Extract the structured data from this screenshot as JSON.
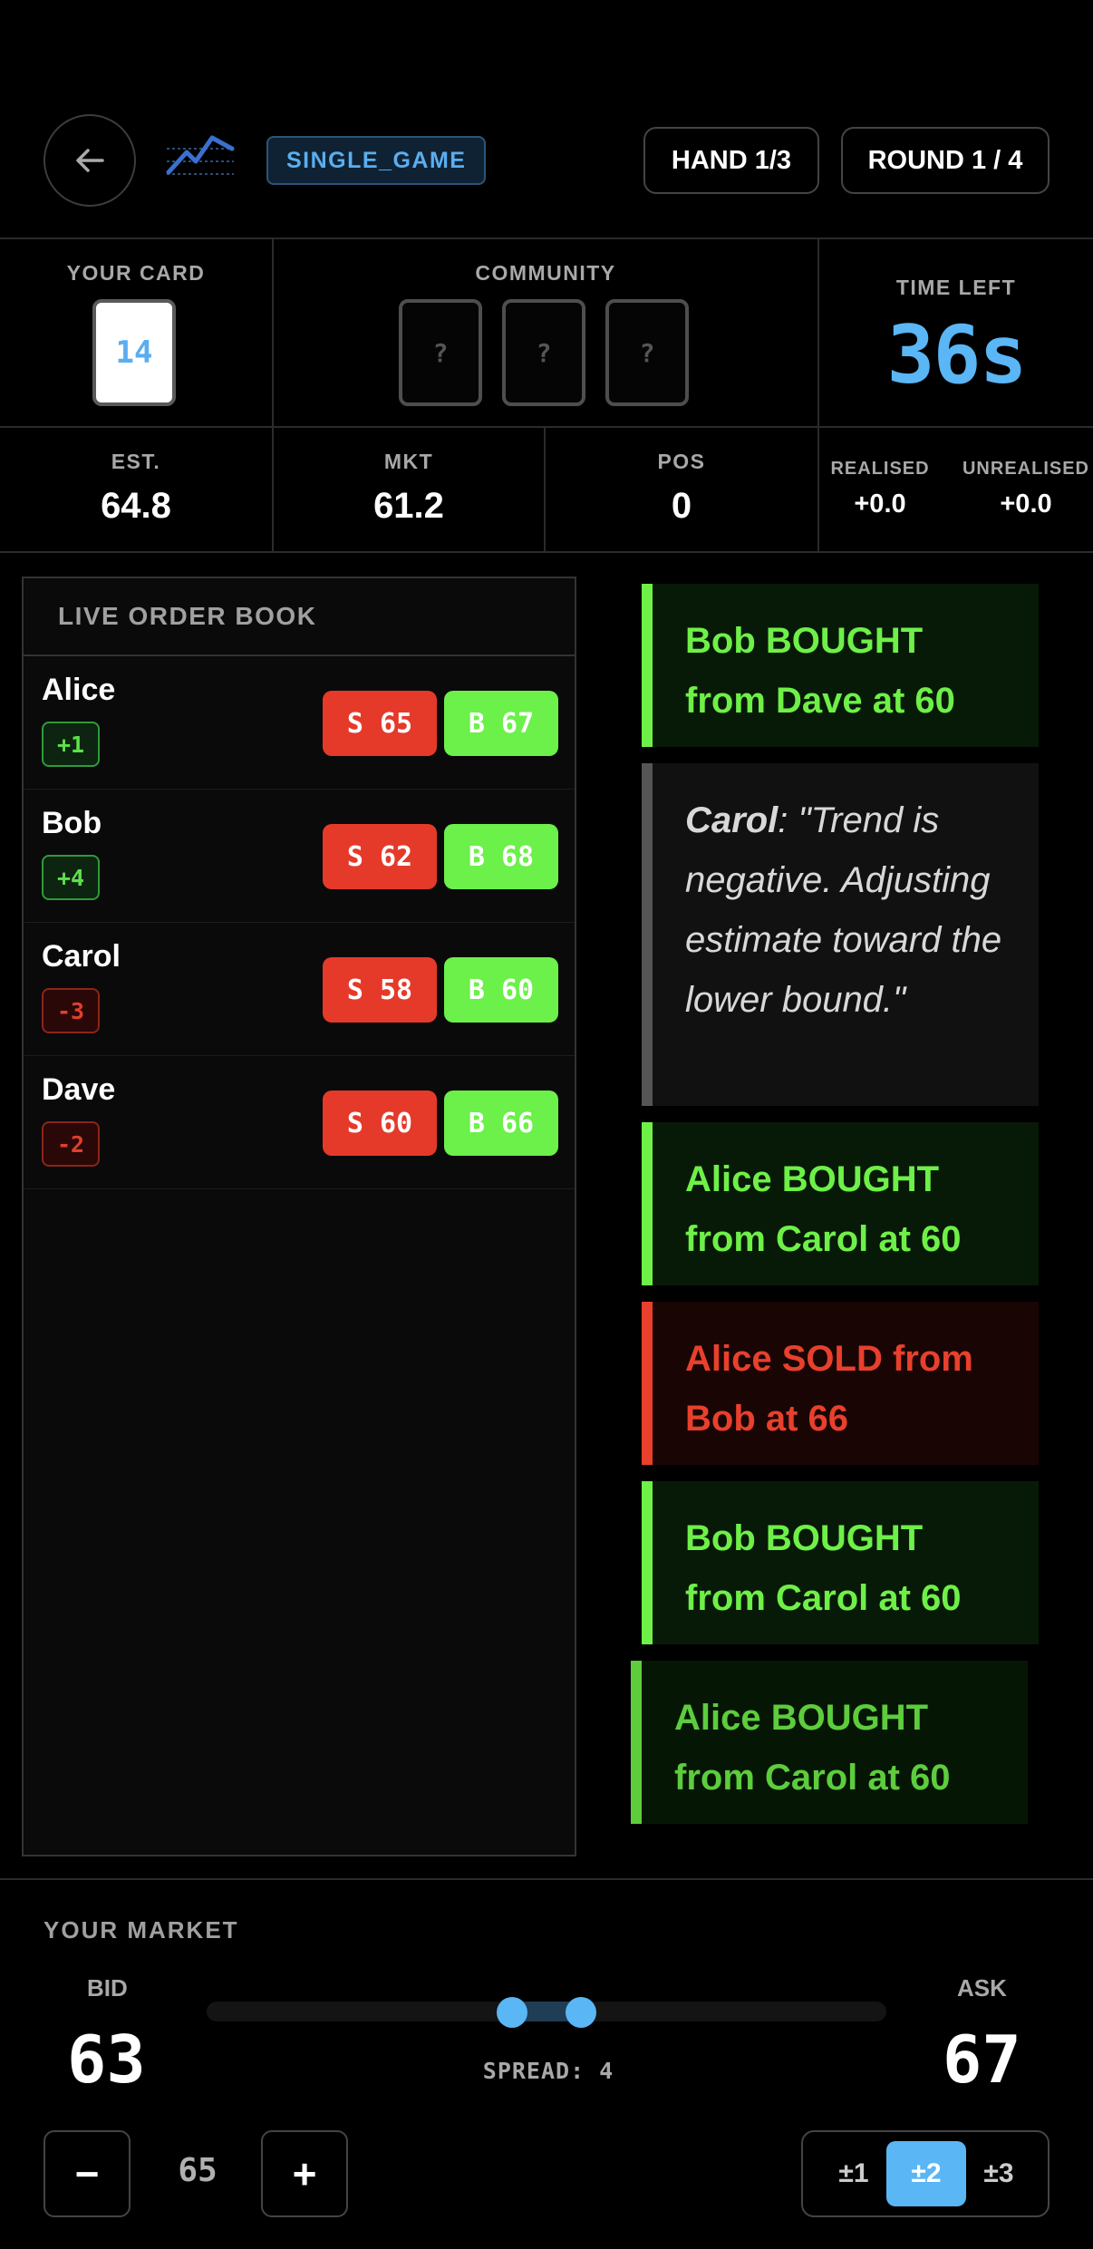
{
  "header": {
    "mode": "SINGLE_GAME",
    "hand": "HAND 1/3",
    "round": "ROUND 1 / 4"
  },
  "cards": {
    "your_card_label": "YOUR CARD",
    "your_card": "14",
    "community_label": "COMMUNITY",
    "community": [
      "?",
      "?",
      "?"
    ],
    "time_left_label": "TIME LEFT",
    "time_left": "36s"
  },
  "stats": {
    "est_label": "EST.",
    "est": "64.8",
    "mkt_label": "MKT",
    "mkt": "61.2",
    "pos_label": "POS",
    "pos": "0",
    "realised_label": "REALISED",
    "realised": "+0.0",
    "unrealised_label": "UNREALISED",
    "unrealised": "+0.0"
  },
  "order_book": {
    "title": "LIVE ORDER BOOK",
    "rows": [
      {
        "name": "Alice",
        "delta": "+1",
        "sell": "S 65",
        "buy": "B 67"
      },
      {
        "name": "Bob",
        "delta": "+4",
        "sell": "S 62",
        "buy": "B 68"
      },
      {
        "name": "Carol",
        "delta": "-3",
        "sell": "S 58",
        "buy": "B 60"
      },
      {
        "name": "Dave",
        "delta": "-2",
        "sell": "S 60",
        "buy": "B 66"
      }
    ]
  },
  "feed": {
    "items": [
      {
        "text": "Bob BOUGHT from Dave at 60"
      },
      {
        "speaker": "Carol",
        "text": ": \"Trend is negative. Adjusting estimate toward the lower bound.\""
      },
      {
        "text": "Alice BOUGHT from Carol at 60"
      },
      {
        "text": "Alice SOLD from Bob at 66"
      },
      {
        "text": "Bob BOUGHT from Carol at 60"
      },
      {
        "text": "Alice BOUGHT from Carol at 60"
      }
    ]
  },
  "market": {
    "title": "YOUR MARKET",
    "bid_label": "BID",
    "bid": "63",
    "ask_label": "ASK",
    "ask": "67",
    "spread": "SPREAD: 4",
    "qty": "65",
    "minus": "−",
    "plus": "+",
    "steps": [
      "±1",
      "±2",
      "±3"
    ],
    "active_step": "±2"
  },
  "colors": {
    "accent": "#5ab6f5",
    "buy": "#6cf04a",
    "sell": "#e53a2a"
  }
}
